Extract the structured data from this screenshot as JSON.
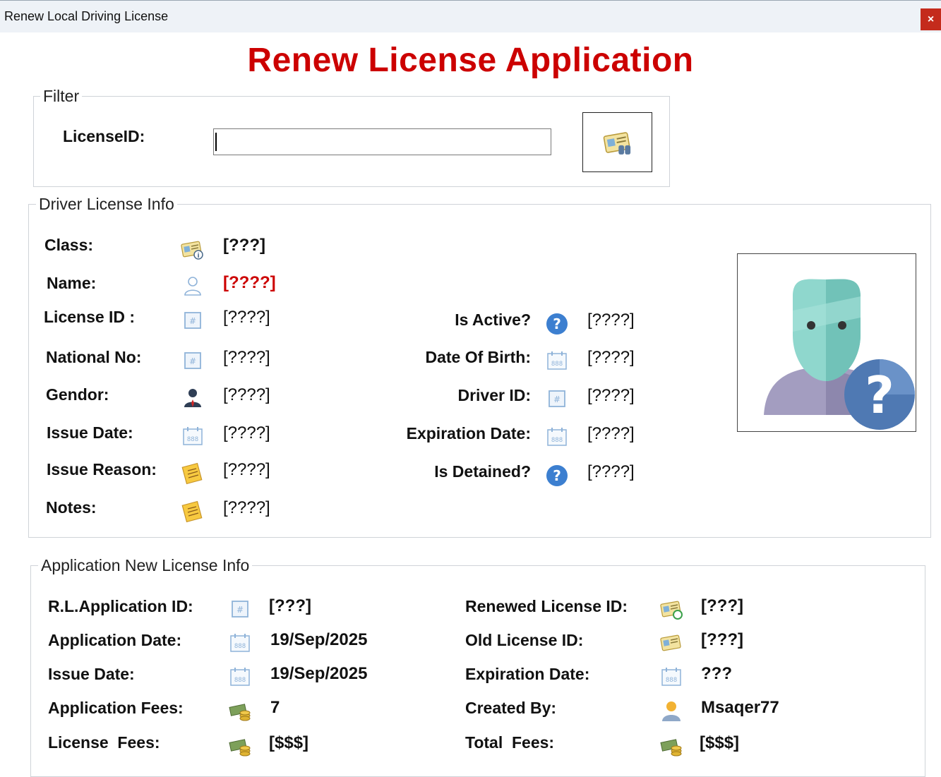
{
  "window": {
    "title": "Renew Local Driving License",
    "close_label": "×"
  },
  "header": {
    "title": "Renew License Application"
  },
  "filter": {
    "legend": "Filter",
    "license_id_label": "LicenseID:",
    "license_id_value": "",
    "search_icon": "license-search-icon"
  },
  "driver_info": {
    "legend": "Driver License Info",
    "left": [
      {
        "label": "Class:",
        "value": "[???]",
        "icon": "license-card-icon"
      },
      {
        "label": "Name:",
        "value": "[????]",
        "icon": "person-outline-icon"
      },
      {
        "label": "License ID :",
        "value": "[????]",
        "icon": "id-number-icon"
      },
      {
        "label": "National No:",
        "value": "[????]",
        "icon": "id-number-icon"
      },
      {
        "label": "Gendor:",
        "value": "[????]",
        "icon": "man-icon"
      },
      {
        "label": "Issue Date:",
        "value": "[????]",
        "icon": "calendar-icon"
      },
      {
        "label": "Issue Reason:",
        "value": "[????]",
        "icon": "note-icon"
      },
      {
        "label": "Notes:",
        "value": "[????]",
        "icon": "note-icon"
      }
    ],
    "right": [
      {
        "label": "Is Active?",
        "value": "[????]",
        "icon": "question-icon"
      },
      {
        "label": "Date Of Birth:",
        "value": "[????]",
        "icon": "calendar-icon"
      },
      {
        "label": "Driver ID:",
        "value": "[????]",
        "icon": "id-number-icon"
      },
      {
        "label": "Expiration Date:",
        "value": "[????]",
        "icon": "calendar-icon"
      },
      {
        "label": "Is Detained?",
        "value": "[????]",
        "icon": "question-icon"
      }
    ],
    "photo_icon": "unknown-person-photo-icon"
  },
  "application_info": {
    "legend": "Application New License Info",
    "left": [
      {
        "label": "R.L.Application ID:",
        "value": "[???]",
        "icon": "id-number-icon"
      },
      {
        "label": "Application Date:",
        "value": "19/Sep/2025",
        "icon": "calendar-icon"
      },
      {
        "label": "Issue Date:",
        "value": "19/Sep/2025",
        "icon": "calendar-icon"
      },
      {
        "label": "Application Fees:",
        "value": "7",
        "icon": "money-icon"
      },
      {
        "label": "License  Fees:",
        "value": "[$$$]",
        "icon": "money-icon"
      }
    ],
    "right": [
      {
        "label": "Renewed License ID:",
        "value": "[???]",
        "icon": "license-renew-icon"
      },
      {
        "label": "Old License ID:",
        "value": "[???]",
        "icon": "license-card-icon"
      },
      {
        "label": "Expiration Date:",
        "value": "???",
        "icon": "calendar-icon"
      },
      {
        "label": "Created By:",
        "value": "Msaqer77",
        "icon": "user-icon"
      },
      {
        "label": "Total  Fees:",
        "value": "[$$$]",
        "icon": "money-icon"
      }
    ]
  }
}
